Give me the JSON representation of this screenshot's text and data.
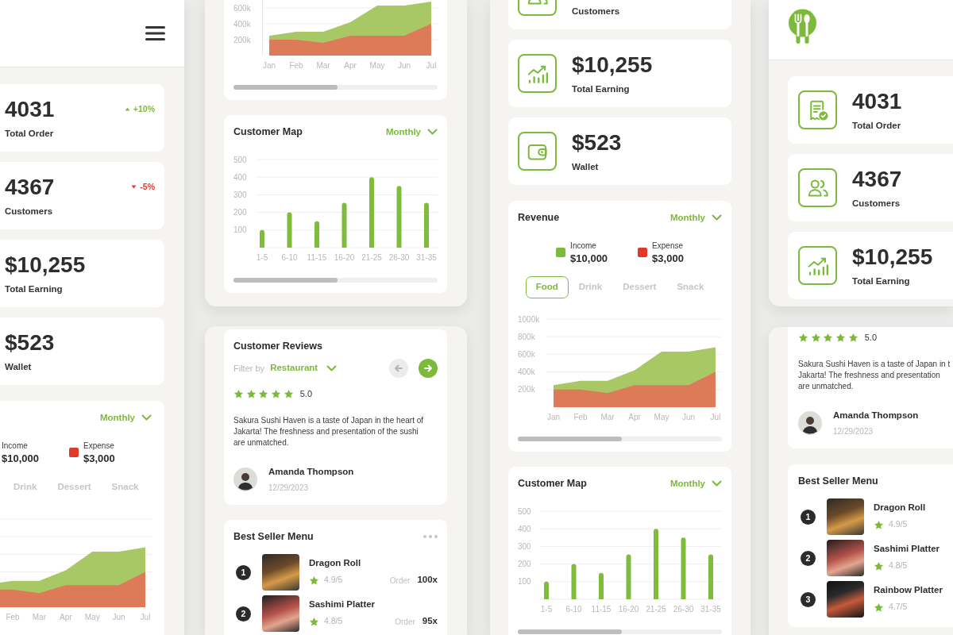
{
  "columns": [
    {
      "panels": [
        {
          "header": {
            "menu_button": true
          },
          "stats": [
            {
              "value": "4031",
              "label": "Total Order",
              "change": {
                "text": "+10%",
                "kind": "up"
              }
            },
            {
              "value": "4367",
              "label": "Customers",
              "change": {
                "text": "-5%",
                "kind": "down"
              }
            },
            {
              "value": "$10,255",
              "label": "Total Earning"
            },
            {
              "value": "$523",
              "label": "Wallet"
            }
          ],
          "revenue": {
            "dropdown": "Monthly",
            "legend": [
              {
                "label": "Income",
                "amount": "$10,000"
              },
              {
                "label": "Expense",
                "amount": "$3,000",
                "color": "#e0392b"
              }
            ],
            "tabs": [
              {
                "label": "Drink",
                "selected": false
              },
              {
                "label": "Dessert",
                "selected": false
              },
              {
                "label": "Snack",
                "selected": false
              }
            ],
            "chart": {
              "x_labels": [
                "Feb",
                "Mar",
                "Apr",
                "May",
                "Jun",
                "Jul"
              ]
            }
          }
        }
      ]
    },
    {
      "panels": [
        {
          "revenue": {
            "chart_data": {
              "type": "area",
              "categories": [
                "Jan",
                "Feb",
                "Mar",
                "Apr",
                "May",
                "Jun",
                "Jul"
              ],
              "series": [
                {
                  "color": "#a8c866",
                  "values": [
                    250000,
                    300000,
                    300000,
                    420000,
                    630000,
                    630000,
                    680000
                  ]
                },
                {
                  "color": "#dd7a57",
                  "values": [
                    200000,
                    200000,
                    160000,
                    250000,
                    250000,
                    250000,
                    400000
                  ]
                }
              ],
              "stacked": false,
              "ylim": [
                0,
                700000
              ],
              "yticks": [
                {
                  "value": 200000,
                  "label": "200k"
                },
                {
                  "value": 400000,
                  "label": "400k"
                },
                {
                  "value": 600000,
                  "label": "600k"
                }
              ],
              "grid": true
            }
          },
          "customer_map": {
            "title": "Customer Map",
            "dropdown": "Monthly",
            "chart_data": {
              "type": "bar",
              "categories": [
                "1-5",
                "6-10",
                "11-15",
                "16-20",
                "21-25",
                "26-30",
                "31-35"
              ],
              "values": [
                100,
                200,
                150,
                255,
                400,
                350,
                255
              ],
              "ylim": [
                0,
                500
              ],
              "yticks": [
                100,
                200,
                300,
                400,
                500
              ],
              "grid": true
            }
          }
        },
        {
          "reviews": {
            "title": "Customer Reviews",
            "filter_label": "Filter by",
            "filter_value": "Restaurant",
            "nav": [
              {
                "kind": "prev",
                "disabled": true
              },
              {
                "kind": "next",
                "disabled": false
              }
            ],
            "stars": 5,
            "rating": "5.0",
            "lines": [
              "Sakura Sushi Haven is a taste of Japan in the heart of",
              "Jakarta! The freshness and presentation of the sushi",
              "are unmatched."
            ],
            "author": "Amanda Thompson",
            "date": "12/29/2023"
          },
          "best_seller": {
            "title": "Best Seller Menu",
            "more_menu": true,
            "items": [
              {
                "rank": "1",
                "name": "Dragon Roll",
                "rating": "4.9/5",
                "order_label": "Order",
                "orders": "100x"
              },
              {
                "rank": "2",
                "name": "Sashimi Platter",
                "rating": "4.8/5",
                "order_label": "Order",
                "orders": "95x"
              }
            ]
          }
        }
      ]
    },
    {
      "panels": [
        {
          "stats": [
            {
              "kind": "customers",
              "label": "Customers"
            },
            {
              "kind": "earning",
              "value": "$10,255",
              "label": "Total Earning"
            },
            {
              "kind": "wallet",
              "value": "$523",
              "label": "Wallet"
            }
          ],
          "revenue": {
            "title": "Revenue",
            "dropdown": "Monthly",
            "legend": [
              {
                "label": "Income",
                "amount": "$10,000",
                "color": "#7cba3b"
              },
              {
                "label": "Expense",
                "amount": "$3,000",
                "color": "#e0392b"
              }
            ],
            "tabs": [
              {
                "label": "Food",
                "selected": true
              },
              {
                "label": "Drink",
                "selected": false
              },
              {
                "label": "Dessert",
                "selected": false
              },
              {
                "label": "Snack",
                "selected": false
              }
            ],
            "chart_data": {
              "type": "area",
              "categories": [
                "Jan",
                "Feb",
                "Mar",
                "Apr",
                "May",
                "Jun",
                "Jul"
              ],
              "series": [
                {
                  "color": "#a8c866",
                  "values": [
                    250000,
                    300000,
                    300000,
                    420000,
                    630000,
                    630000,
                    680000
                  ]
                },
                {
                  "color": "#dd7a57",
                  "values": [
                    200000,
                    200000,
                    160000,
                    250000,
                    250000,
                    250000,
                    400000
                  ]
                }
              ],
              "stacked": false,
              "ylim": [
                0,
                1000000
              ],
              "yticks": [
                {
                  "value": 200000,
                  "label": "200k"
                },
                {
                  "value": 400000,
                  "label": "400k"
                },
                {
                  "value": 600000,
                  "label": "600k"
                },
                {
                  "value": 800000,
                  "label": "800k"
                },
                {
                  "value": 1000000,
                  "label": "1000k"
                }
              ],
              "grid": true
            }
          },
          "customer_map": {
            "title": "Customer Map",
            "dropdown": "Monthly",
            "chart_data": {
              "type": "bar",
              "categories": [
                "1-5",
                "6-10",
                "11-15",
                "16-20",
                "21-25",
                "26-30",
                "31-35"
              ],
              "values": [
                100,
                200,
                150,
                255,
                400,
                350,
                255
              ],
              "ylim": [
                0,
                500
              ],
              "yticks": [
                100,
                200,
                300,
                400,
                500
              ],
              "grid": true
            }
          }
        }
      ]
    },
    {
      "panels": [
        {
          "header": {
            "logo": true
          },
          "stats": [
            {
              "kind": "orders",
              "value": "4031",
              "label": "Total Order"
            },
            {
              "kind": "customers",
              "value": "4367",
              "label": "Customers"
            },
            {
              "kind": "earning",
              "value": "$10,255",
              "label": "Total Earning"
            }
          ]
        },
        {
          "reviews": {
            "stars": 5,
            "rating": "5.0",
            "lines": [
              "Sakura Sushi Haven is a taste of Japan in t",
              "Jakarta! The freshness and presentation",
              "are unmatched."
            ],
            "author": "Amanda Thompson",
            "date": "12/29/2023"
          },
          "best_seller": {
            "title": "Best Seller Menu",
            "items": [
              {
                "rank": "1",
                "name": "Dragon Roll",
                "rating": "4.9/5"
              },
              {
                "rank": "2",
                "name": "Sashimi Platter",
                "rating": "4.8/5"
              },
              {
                "rank": "3",
                "name": "Rainbow Platter",
                "rating": "4.7/5"
              }
            ]
          }
        }
      ]
    }
  ]
}
